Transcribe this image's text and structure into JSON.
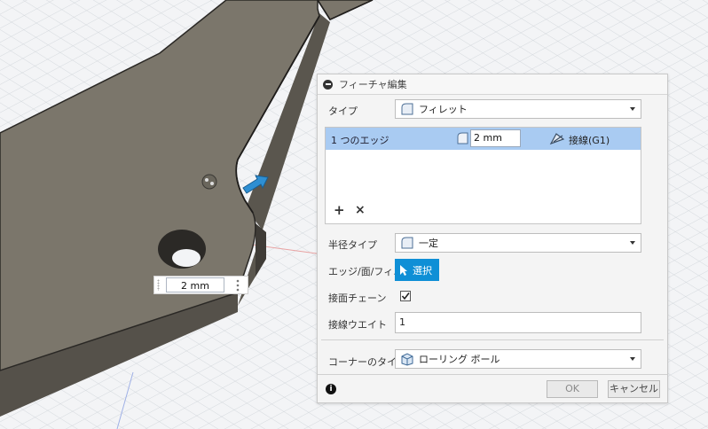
{
  "dialog": {
    "title": "フィーチャ編集",
    "type_label": "タイプ",
    "type_value": "フィレット",
    "edge_row": {
      "label": "1 つのエッジ",
      "radius_value": "2 mm",
      "tangent_label": "接線(G1)"
    },
    "radius_type_label": "半径タイプ",
    "radius_type_value": "一定",
    "edge_select_label": "エッジ/面/フィ…",
    "select_button_label": "選択",
    "tangent_chain_label": "接面チェーン",
    "tangent_chain_checked": true,
    "tangent_weight_label": "接線ウエイト",
    "tangent_weight_value": "1",
    "corner_type_label": "コーナーのタイプ",
    "corner_type_value": "ローリング ボール",
    "ok_label": "OK",
    "cancel_label": "キャンセル"
  },
  "viewport": {
    "dimension_value": "2 mm"
  },
  "colors": {
    "row_highlight": "#a9cbf2",
    "accent_blue": "#0f8fd6",
    "part_face": "#7b766b",
    "part_side": "#5a564e"
  }
}
